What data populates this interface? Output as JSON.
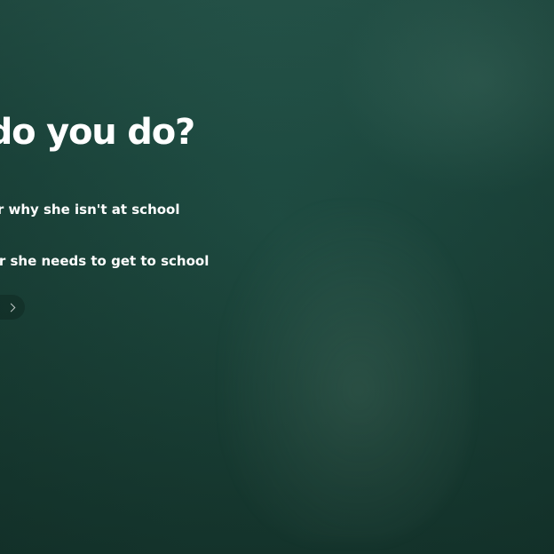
{
  "question": {
    "title": "hat do you do?"
  },
  "options": [
    {
      "label": "her why she isn't at school"
    },
    {
      "label": "her she needs to get to school"
    }
  ],
  "next": {
    "icon": "chevron-right-icon"
  }
}
